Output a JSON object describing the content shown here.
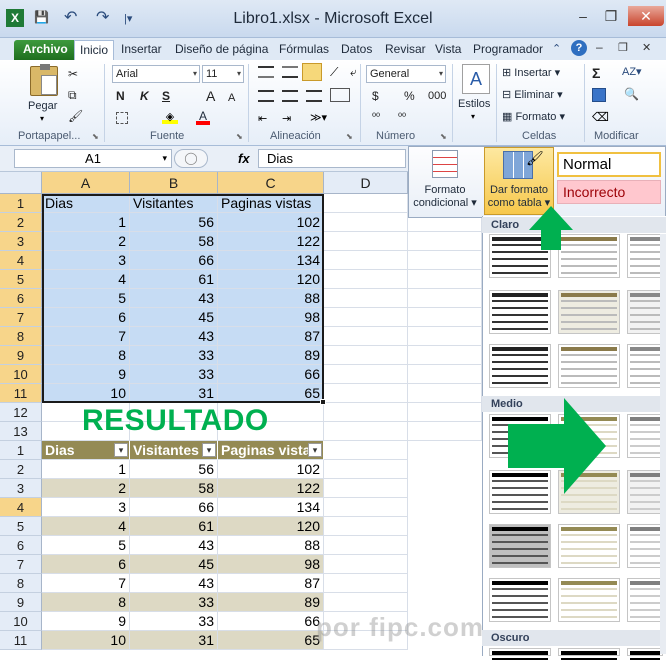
{
  "window": {
    "title": "Libro1.xlsx - Microsoft Excel",
    "minimize": "–",
    "restore": "❐",
    "close": "✕"
  },
  "qat": {
    "excel_icon": "X",
    "save": "💾",
    "undo": "↶",
    "redo": "↷",
    "customize": "|▾"
  },
  "tabs": [
    "Archivo",
    "Inicio",
    "Insertar",
    "Diseño de página",
    "Fórmulas",
    "Datos",
    "Revisar",
    "Vista",
    "Programador"
  ],
  "ribbon": {
    "clipboard": {
      "paste": "Pegar",
      "label": "Portapapel..."
    },
    "font": {
      "name": "Arial",
      "size": "11",
      "bold": "N",
      "italic": "K",
      "underline": "S",
      "grow": "A",
      "shrink": "A",
      "label": "Fuente"
    },
    "alignment": {
      "label": "Alineación"
    },
    "number": {
      "format": "General",
      "currency": "$",
      "percent": "%",
      "thousands": "000",
      "label": "Número"
    },
    "styles": {
      "estilos": "Estilos",
      "label": "Estilos"
    },
    "cells": {
      "insert": "Insertar",
      "delete": "Eliminar",
      "format": "Formato",
      "label": "Celdas"
    },
    "edit": {
      "sum": "Σ",
      "label": "Modificar"
    }
  },
  "formula_bar": {
    "name_box": "A1",
    "fx": "fx",
    "content": "Dias"
  },
  "styles_dropdown": {
    "cond_format": [
      "Formato",
      "condicional ▾"
    ],
    "table_format": [
      "Dar formato",
      "como tabla ▾"
    ],
    "style_normal": "Normal",
    "style_bad": "Incorrecto"
  },
  "grid": {
    "columns": [
      "A",
      "B",
      "C",
      "D"
    ],
    "headers": [
      "Dias",
      "Visitantes",
      "Paginas vistas"
    ],
    "rows": [
      [
        1,
        56,
        102
      ],
      [
        2,
        58,
        122
      ],
      [
        3,
        66,
        134
      ],
      [
        4,
        61,
        120
      ],
      [
        5,
        43,
        88
      ],
      [
        6,
        45,
        98
      ],
      [
        7,
        43,
        87
      ],
      [
        8,
        33,
        89
      ],
      [
        9,
        33,
        66
      ],
      [
        10,
        31,
        65
      ]
    ],
    "row_numbers_top": [
      "1",
      "2",
      "3",
      "4",
      "5",
      "6",
      "7",
      "8",
      "9",
      "10",
      "11",
      "12",
      "13"
    ],
    "row_numbers_bottom": [
      "1",
      "2",
      "3",
      "4",
      "5",
      "6",
      "7",
      "8",
      "9",
      "10",
      "11"
    ],
    "result_label": "RESULTADO"
  },
  "gallery": {
    "light": "Claro",
    "medium": "Medio",
    "dark": "Oscuro"
  },
  "watermark": "por fipc.com",
  "colors": {
    "accent_green": "#00b050",
    "table_header": "#948a54",
    "band": "#ddd9c4",
    "selection": "#c6dcf4"
  }
}
